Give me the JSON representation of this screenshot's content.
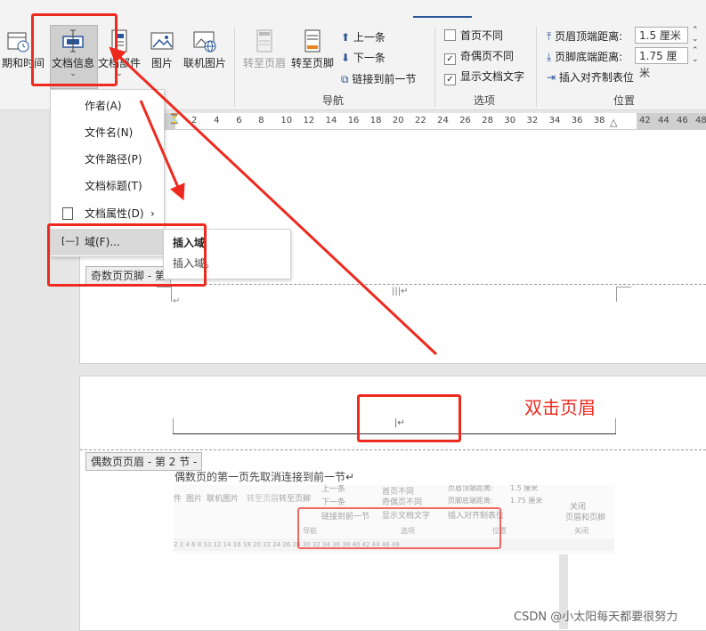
{
  "ribbon": {
    "buttons": {
      "date_time": "日期和时间",
      "doc_info": "文档信息",
      "doc_parts": "文档部件",
      "picture": "图片",
      "online_picture": "联机图片",
      "goto_header": "转至页眉",
      "goto_footer": "转至页脚"
    },
    "nav": {
      "prev": "上一条",
      "next": "下一条",
      "link_prev": "链接到前一节",
      "group": "导航"
    },
    "options": {
      "diff_first": "首页不同",
      "odd_even": "奇偶页不同",
      "show_text": "显示文档文字",
      "group": "选项",
      "diff_first_checked": false,
      "odd_even_checked": true,
      "show_text_checked": true
    },
    "position": {
      "header_top": "页眉顶端距离:",
      "header_top_val": "1.5 厘米",
      "footer_bottom": "页脚底端距离:",
      "footer_bottom_val": "1.75 厘米",
      "insert_align_tab": "插入对齐制表位",
      "group": "位置"
    }
  },
  "menu": {
    "items": [
      "作者(A)",
      "文件名(N)",
      "文件路径(P)",
      "文档标题(T)",
      "文档属性(D)",
      "域(F)..."
    ],
    "submenu_title": "插入域",
    "submenu_desc": "插入域。"
  },
  "ruler_ticks": [
    "2",
    "4",
    "6",
    "8",
    "10",
    "12",
    "14",
    "16",
    "18",
    "20",
    "22",
    "24",
    "26",
    "28",
    "30",
    "32",
    "34",
    "36",
    "38",
    "42",
    "44",
    "46",
    "48"
  ],
  "document": {
    "odd_footer_tag": "奇数页页脚 - 第",
    "even_header_tag": "偶数页页眉 - 第 2 节 -",
    "para_mark": "↵",
    "instruction": "偶数页的第一页先取消连接到前一节↵",
    "annotation": "双击页眉"
  },
  "thumb": {
    "parts": "件",
    "picture": "图片",
    "online_picture": "联机图片",
    "goto_header": "转至页眉",
    "goto_footer": "转至页脚",
    "prev": "上一条",
    "next": "下一条",
    "link_prev": "链接到前一节",
    "diff_first": "首页不同",
    "odd_even": "奇偶页不同",
    "show_text": "显示文档文字",
    "header_top": "页眉顶端距离:",
    "header_top_val": "1.5 厘米",
    "footer_bottom": "页脚底端距离:",
    "footer_bottom_val": "1.75 厘米",
    "insert_align_tab": "插入对齐制表位",
    "close": "关闭",
    "close_hf": "页眉和页脚",
    "nav_group": "导航",
    "options_group": "选项",
    "position_group": "位置",
    "close_group": "关闭",
    "ruler": "2  2  4  6  8  10  12  14  16  18  20  22  24  26  28  30  32  34  36  38  40  42  44  46  48"
  },
  "watermark": "CSDN @小太阳每天都要很努力",
  "colors": {
    "accent_red": "#ee2a1f",
    "ribbon_bg": "#f3f3f3",
    "page_bg": "#ffffff",
    "workspace": "#e6e6e6"
  }
}
